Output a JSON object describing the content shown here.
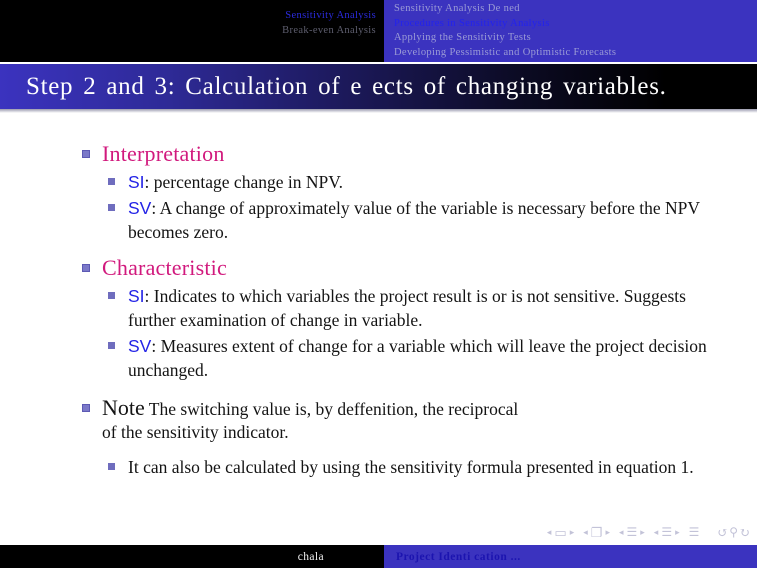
{
  "navbar": {
    "left_section": [
      {
        "label": "Sensitivity Analysis",
        "active": true
      },
      {
        "label": "Break-even  Analysis",
        "active": false
      }
    ],
    "right_section": [
      {
        "label": "Sensitivity Analysis De ned",
        "active": false
      },
      {
        "label": "Procedures  in  Sensitivity  Analysis",
        "active": true
      },
      {
        "label": "Applying  the  Sensitivity  Tests",
        "active": false
      },
      {
        "label": "Developing  Pessimistic  and  Optimistic  Forecasts",
        "active": false
      }
    ]
  },
  "title": "Step  2  and  3:  Calculation  of  e ects  of  changing  variables.",
  "content": {
    "block1": {
      "heading": "Interpretation",
      "items": [
        {
          "tag": "SI",
          "text": ": percentage change in NPV."
        },
        {
          "tag": "SV",
          "text": ": A change of approximately value of the variable is necessary before the NPV becomes zero."
        }
      ]
    },
    "block2": {
      "heading": "Characteristic",
      "items": [
        {
          "tag": "SI",
          "text": ": Indicates to which variables the project result is or is not sensitive.  Suggests further examination of change in variable."
        },
        {
          "tag": "SV",
          "text": ": Measures extent of change for a variable which will leave the project decision unchanged."
        }
      ]
    },
    "block3": {
      "heading": "Note",
      "text": "The switching value is, by deffenition, the reciprocal",
      "text_line2": "of the sensitivity indicator.",
      "subitem": "It can also be calculated by using the sensitivity formula presented in equation 1."
    }
  },
  "nav_symbols": {
    "prev_frame": "◂",
    "frame_icon": "▭",
    "next_frame": "▸",
    "prev_subsection": "◂",
    "subsection_icon": "❐",
    "next_subsection": "▸",
    "prev_section": "◂",
    "section_icon": "☰",
    "next_section": "▸",
    "prev_part": "◂",
    "part_icon": "☰",
    "next_part": "▸",
    "doc_icon": "☰",
    "back_icon": "↺",
    "search_icon": "⚲",
    "forward_icon": "↻"
  },
  "footer": {
    "author": "chala",
    "document": "Project Identi cation ..."
  },
  "colors": {
    "brand_blue": "#3b33bf",
    "heading_pink": "#d1197d",
    "tag_blue": "#2323e6",
    "bullet_purple": "#7b79c9",
    "title_bar_start": "#3b33bf",
    "title_bar_end": "#000000"
  }
}
